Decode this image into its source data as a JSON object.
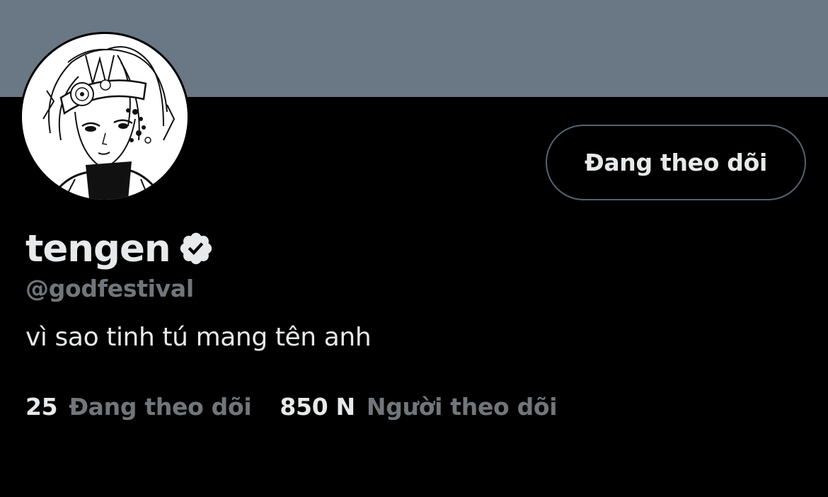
{
  "profile": {
    "display_name": "tengen",
    "handle": "@godfestival",
    "bio": "vì sao tinh tú mang tên anh",
    "verified": true,
    "avatar_icon": "manga-character-avatar",
    "verified_icon": "verified-badge-icon"
  },
  "actions": {
    "follow_button_label": "Đang theo dõi"
  },
  "stats": {
    "following_count": "25",
    "following_label": "Đang theo dõi",
    "followers_count": "850 N",
    "followers_label": "Người theo dõi"
  },
  "colors": {
    "banner": "#6a7785",
    "background": "#000000",
    "primary_text": "#e7e9ea",
    "secondary_text": "#71767b",
    "button_border": "#536471"
  }
}
